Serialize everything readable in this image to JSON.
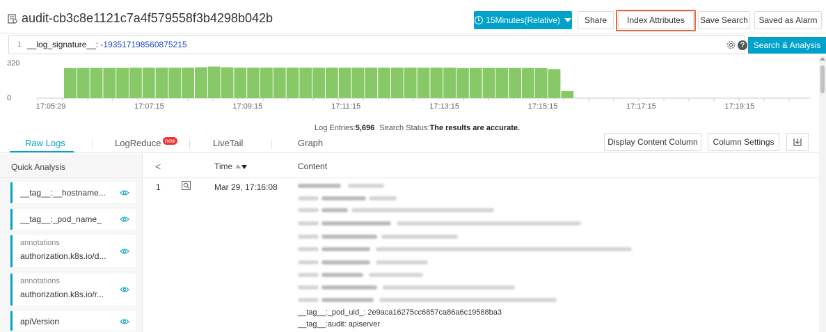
{
  "header": {
    "logstore_name": "audit-cb3c8e1121c7a4f579558f3b4298b042b",
    "time_range_label": "15Minutes(Relative)",
    "share_label": "Share",
    "index_attributes_label": "Index Attributes",
    "save_search_label": "Save Search",
    "saved_as_alarm_label": "Saved as Alarm",
    "accent_color": "#00a2ca",
    "highlight_color": "#e8663d"
  },
  "query": {
    "line_number": "1",
    "field": "__log_signature__: ",
    "value": "-193517198560875215",
    "search_button_label": "Search & Analysis"
  },
  "histogram": {
    "y_max_label": "320",
    "y_min_label": "0",
    "bar_color": "#86c966",
    "x_ticks": [
      "17:05:29",
      "17:07:15",
      "17:09:15",
      "17:11:15",
      "17:13:15",
      "17:15:15",
      "17:17:15",
      "17:19:15"
    ],
    "bars": [
      300,
      302,
      302,
      302,
      302,
      304,
      304,
      304,
      304,
      304,
      308,
      316,
      308,
      304,
      304,
      304,
      304,
      304,
      304,
      304,
      304,
      304,
      304,
      304,
      304,
      304,
      304,
      304,
      304,
      304,
      300,
      302,
      302,
      302,
      302,
      302,
      300,
      290,
      70
    ]
  },
  "status": {
    "log_entries_label": "Log Entries:",
    "log_entries_value": "5,696",
    "search_status_label": "Search Status:",
    "search_status_value": "The results are accurate."
  },
  "tabs": {
    "raw_logs": "Raw Logs",
    "log_reduce": "LogReduce",
    "new_badge": "new",
    "live_tail": "LiveTail",
    "graph": "Graph",
    "display_content_column": "Display Content Column",
    "column_settings": "Column Settings"
  },
  "sidebar": {
    "title": "Quick Analysis",
    "fields": [
      {
        "name": "__tag__:__hostname..."
      },
      {
        "name": "__tag__:_pod_name_"
      },
      {
        "prefix": "annotations",
        "name": "authorization.k8s.io/d..."
      },
      {
        "prefix": "annotations",
        "name": "authorization.k8s.io/r..."
      },
      {
        "name": "apiVersion"
      }
    ]
  },
  "table": {
    "collapse_glyph": "<",
    "time_header": "Time",
    "content_header": "Content",
    "rows": [
      {
        "index": "1",
        "time": "Mar 29, 17:16:08",
        "visible_lines": [
          {
            "key": "__tag__:_pod_uid_:",
            "value": "2e9aca16275cc6857ca86a6c19588ba3"
          },
          {
            "key": "__tag__:audit:",
            "value": "apiserver"
          }
        ]
      }
    ]
  }
}
